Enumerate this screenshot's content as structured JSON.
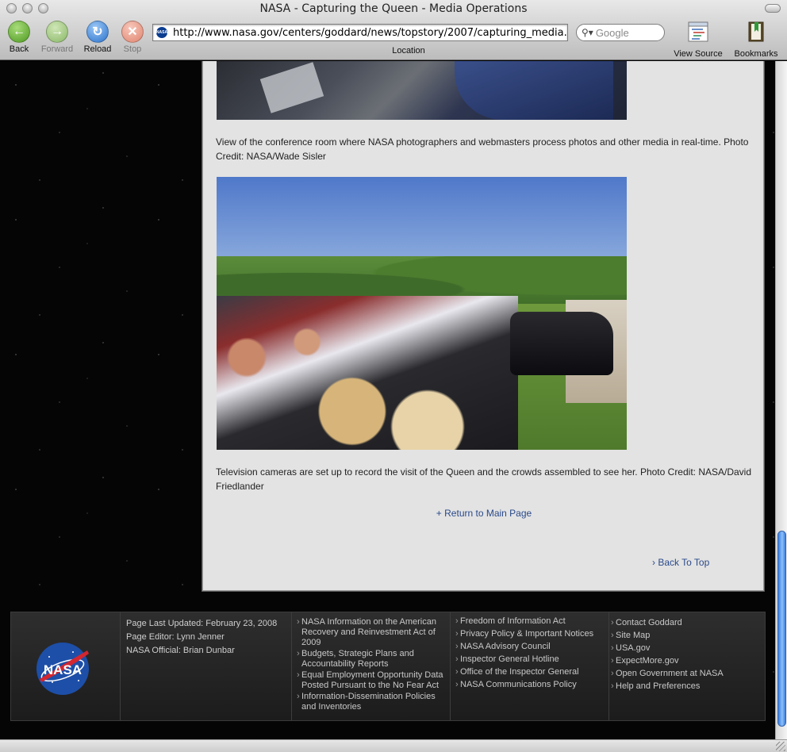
{
  "window": {
    "title": "NASA - Capturing the Queen - Media Operations"
  },
  "toolbar": {
    "back_label": "Back",
    "forward_label": "Forward",
    "reload_label": "Reload",
    "stop_label": "Stop",
    "url": "http://www.nasa.gov/centers/goddard/news/topstory/2007/capturing_media.html",
    "location_label": "Location",
    "search_placeholder": "Google",
    "view_source_label": "View Source",
    "bookmarks_label": "Bookmarks"
  },
  "content": {
    "caption1": "View of the conference room where NASA photographers and webmasters process photos and other media in real-time. Photo Credit: NASA/Wade Sisler",
    "caption2": "Television cameras are set up to record the visit of the Queen and the crowds assembled to see her. Photo Credit: NASA/David Friedlander",
    "return_link": "+ Return to Main Page",
    "back_to_top": "› Back To Top"
  },
  "footer": {
    "logo_text": "NASA",
    "page_last_updated": "Page Last Updated: February 23, 2008",
    "page_editor": "Page Editor: Lynn Jenner",
    "nasa_official": "NASA Official: Brian Dunbar",
    "links_col1": [
      "NASA Information on the American Recovery and Reinvestment Act of 2009",
      "Budgets, Strategic Plans and Accountability Reports",
      "Equal Employment Opportunity Data Posted Pursuant to the No Fear Act",
      "Information-Dissemination Policies and Inventories"
    ],
    "links_col2": [
      "Freedom of Information Act",
      "Privacy Policy & Important Notices",
      "NASA Advisory Council",
      "Inspector General Hotline",
      "Office of the Inspector General",
      "NASA Communications Policy"
    ],
    "links_col3": [
      "Contact Goddard",
      "Site Map",
      "USA.gov",
      "ExpectMore.gov",
      "Open Government at NASA",
      "Help and Preferences"
    ]
  },
  "colors": {
    "link": "#2a4a8a",
    "panel_bg": "#e3e3e3",
    "footer_bg": "#262626",
    "back_btn": "#5fae2f",
    "forward_btn": "#9dc87a",
    "reload_btn": "#3d8de0",
    "stop_btn": "#e89a88"
  }
}
